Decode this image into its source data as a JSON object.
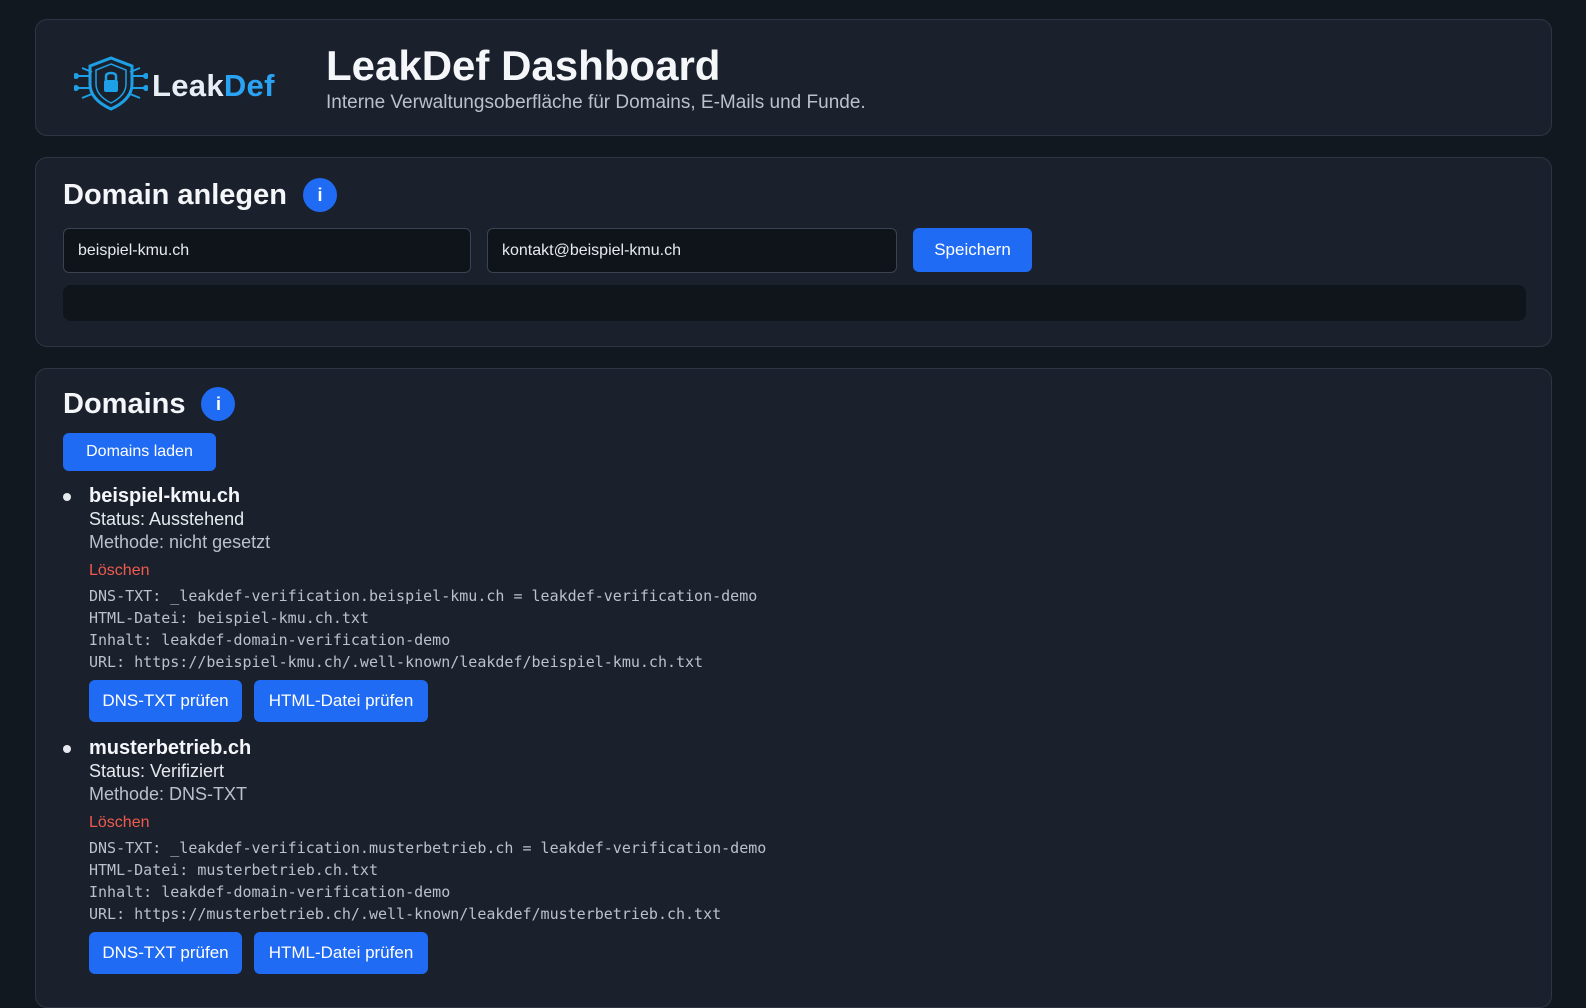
{
  "header": {
    "logo": {
      "part1": "Leak",
      "part2": "Def"
    },
    "title": "LeakDef Dashboard",
    "subtitle": "Interne Verwaltungsoberfläche für Domains, E-Mails und Funde."
  },
  "create_domain": {
    "title": "Domain anlegen",
    "info": "i",
    "domain_value": "beispiel-kmu.ch",
    "email_value": "kontakt@beispiel-kmu.ch",
    "save_label": "Speichern"
  },
  "domains": {
    "title": "Domains",
    "info": "i",
    "load_label": "Domains laden",
    "items": [
      {
        "name": "beispiel-kmu.ch",
        "status": "Status: Ausstehend",
        "method": "Methode: nicht gesetzt",
        "delete_label": "Löschen",
        "dns_txt": "DNS-TXT: _leakdef-verification.beispiel-kmu.ch = leakdef-verification-demo",
        "html_file": "HTML-Datei: beispiel-kmu.ch.txt",
        "content": "Inhalt: leakdef-domain-verification-demo",
        "url": "URL: https://beispiel-kmu.ch/.well-known/leakdef/beispiel-kmu.ch.txt",
        "check_dns_label": "DNS-TXT prüfen",
        "check_html_label": "HTML-Datei prüfen"
      },
      {
        "name": "musterbetrieb.ch",
        "status": "Status: Verifiziert",
        "method": "Methode: DNS-TXT",
        "delete_label": "Löschen",
        "dns_txt": "DNS-TXT: _leakdef-verification.musterbetrieb.ch = leakdef-verification-demo",
        "html_file": "HTML-Datei: musterbetrieb.ch.txt",
        "content": "Inhalt: leakdef-domain-verification-demo",
        "url": "URL: https://musterbetrieb.ch/.well-known/leakdef/musterbetrieb.ch.txt",
        "check_dns_label": "DNS-TXT prüfen",
        "check_html_label": "HTML-Datei prüfen"
      }
    ]
  },
  "colors": {
    "background": "#121820",
    "card": "#1a212c",
    "accent": "#1f6bf3",
    "logo_accent": "#2aa3f5",
    "danger": "#f05a4f"
  }
}
